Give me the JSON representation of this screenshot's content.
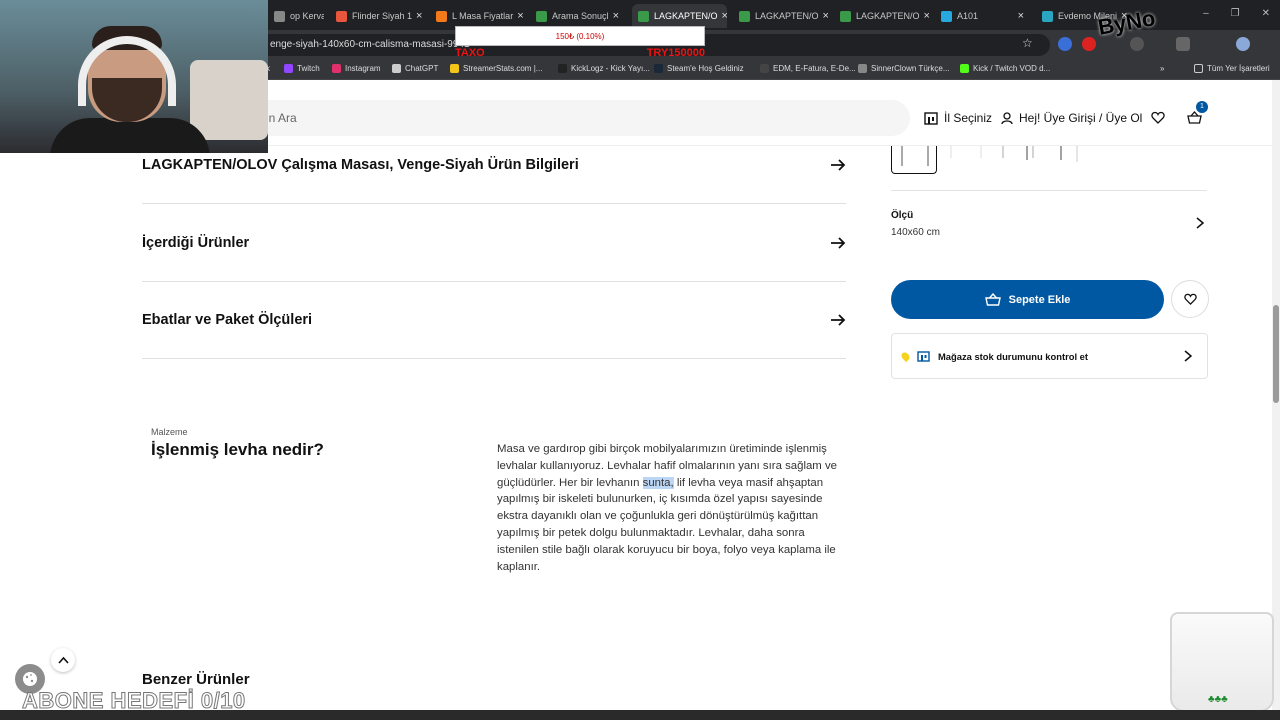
{
  "browser": {
    "tabs": [
      {
        "label": "op Kerva",
        "color": "#888888",
        "active": false
      },
      {
        "label": "Flinder Siyah 1",
        "color": "#e8573c",
        "active": false
      },
      {
        "label": "L Masa Fiyatlar",
        "color": "#f27a1a",
        "active": false
      },
      {
        "label": "Arama Sonuçl",
        "color": "#3a9a4a",
        "active": false
      },
      {
        "label": "LAGKAPTEN/O",
        "color": "#3a9a4a",
        "active": true
      },
      {
        "label": "LAGKAPTEN/O",
        "color": "#3a9a4a",
        "active": false
      },
      {
        "label": "LAGKAPTEN/O",
        "color": "#3a9a4a",
        "active": false
      },
      {
        "label": "A101",
        "color": "#27a9e0",
        "active": false
      },
      {
        "label": "Evdemo Mileni",
        "color": "#2aa6c0",
        "active": false
      }
    ],
    "url": "enge-siyah-140x60-cm-calisma-masasi-9941",
    "bookmarks": [
      {
        "label": "k",
        "color": "#888888"
      },
      {
        "label": "Twitch",
        "color": "#9146ff"
      },
      {
        "label": "Instagram",
        "color": "#e1306c"
      },
      {
        "label": "ChatGPT",
        "color": "#cccccc"
      },
      {
        "label": "StreamerStats.com |...",
        "color": "#f5c518"
      },
      {
        "label": "KickLogz - Kick Yayı...",
        "color": "#222222"
      },
      {
        "label": "Steam'e Hoş Geldiniz",
        "color": "#1b2838"
      },
      {
        "label": "EDM, E-Fatura, E-De...",
        "color": "#444444"
      },
      {
        "label": "SinnerClown Türkçe...",
        "color": "#888888"
      },
      {
        "label": "Kick / Twitch VOD d...",
        "color": "#53fc18"
      }
    ],
    "all_bookmarks": "Tüm Yer İşaretleri",
    "more": "»"
  },
  "overlay": {
    "ticker": "150₺ (0.10%)",
    "left_label": "TAXO",
    "right_label": "TRY150000",
    "logo": "ByNo",
    "subscribe_goal": "ABONE HEDEFİ 0/10"
  },
  "header": {
    "search_placeholder": "ün Ara",
    "store_label": "İl Seçiniz",
    "login_label": "Hej! Üye Girişi / Üye Ol",
    "cart_count": "1"
  },
  "accordion": [
    {
      "label": "LAGKAPTEN/OLOV Çalışma Masası, Venge-Siyah Ürün Bilgileri"
    },
    {
      "label": "İçerdiği Ürünler"
    },
    {
      "label": "Ebatlar ve Paket Ölçüleri"
    }
  ],
  "materials": {
    "kicker": "Malzeme",
    "title": "İşlenmiş levha nedir?",
    "text_before": "Masa ve gardırop gibi birçok mobilyalarımızın üretiminde işlenmiş levhalar kullanıyoruz. Levhalar hafif olmalarının yanı sıra sağlam ve güçlüdürler. Her bir levhanın ",
    "text_highlight": "sunta,",
    "text_after": " lif levha veya masif ahşaptan yapılmış bir iskeleti bulunurken, iç kısımda özel yapısı sayesinde ekstra dayanıklı olan ve çoğunlukla geri dönüştürülmüş kağıttan yapılmış bir petek dolgu bulunmaktadır. Levhalar, daha sonra istenilen stile bağlı olarak koruyucu bir boya, folyo veya kaplama ile kaplanır."
  },
  "product_panel": {
    "size_label": "Ölçü",
    "size_value": "140x60 cm",
    "add_to_cart": "Sepete Ekle",
    "stock_check": "Mağaza stok durumunu kontrol et"
  },
  "similar_title": "Benzer Ürünler",
  "colors": {
    "accent": "#0058a3",
    "highlight": "#bcd7f6"
  }
}
